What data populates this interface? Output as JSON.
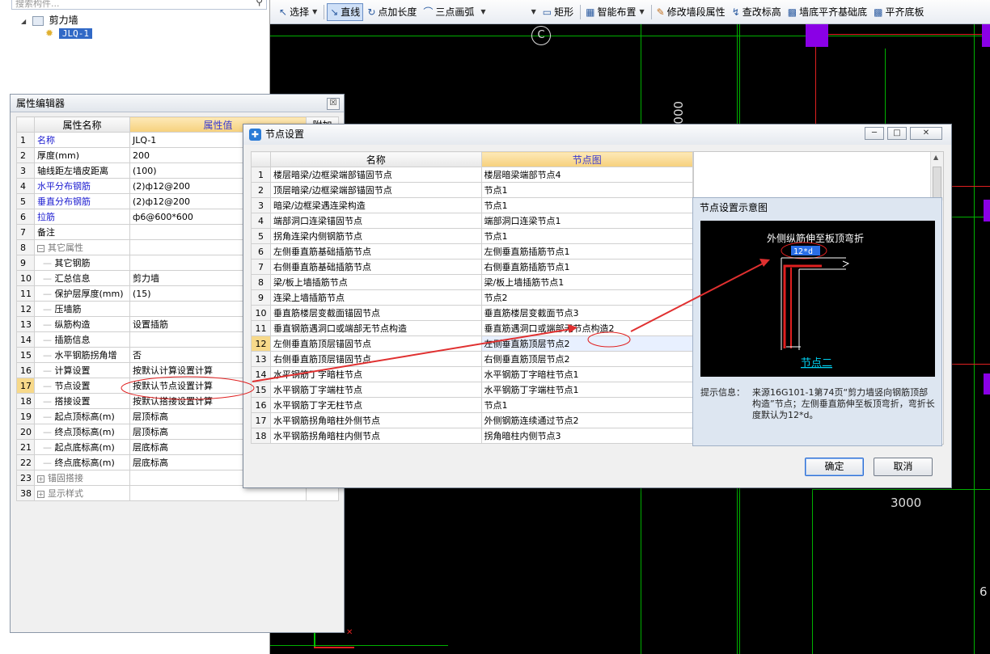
{
  "tree": {
    "search_placeholder": "搜索构件...",
    "root_label": "剪力墙",
    "child_label": "JLQ-1"
  },
  "toolbar": {
    "select": "选择",
    "line": "直线",
    "point_length": "点加长度",
    "arc": "三点画弧",
    "rect": "矩形",
    "smart": "智能布置",
    "modify": "修改墙段属性",
    "elevation": "查改标高",
    "align_base": "墙底平齐基础底",
    "align_slab": "平齐底板"
  },
  "canvas": {
    "axis_label": "C",
    "dim_vertical": "000",
    "dim_3000": "3000",
    "dim_6": "6"
  },
  "property_editor": {
    "title": "属性编辑器",
    "col_name": "属性名称",
    "col_value": "属性值",
    "col_extra": "附加",
    "rows": [
      {
        "num": "1",
        "name": "名称",
        "value": "JLQ-1",
        "style": "blue"
      },
      {
        "num": "2",
        "name": "厚度(mm)",
        "value": "200",
        "style": ""
      },
      {
        "num": "3",
        "name": "轴线距左墙皮距离",
        "value": "(100)",
        "style": ""
      },
      {
        "num": "4",
        "name": "水平分布钢筋",
        "value": "(2)ф12@200",
        "style": "blue"
      },
      {
        "num": "5",
        "name": "垂直分布钢筋",
        "value": "(2)ф12@200",
        "style": "blue"
      },
      {
        "num": "6",
        "name": "拉筋",
        "value": "ф6@600*600",
        "style": "blue"
      },
      {
        "num": "7",
        "name": "备注",
        "value": "",
        "style": ""
      },
      {
        "num": "8",
        "name": "其它属性",
        "value": "",
        "style": "group"
      },
      {
        "num": "9",
        "name": "其它钢筋",
        "value": "",
        "style": "child"
      },
      {
        "num": "10",
        "name": "汇总信息",
        "value": "剪力墙",
        "style": "child"
      },
      {
        "num": "11",
        "name": "保护层厚度(mm)",
        "value": "(15)",
        "style": "child"
      },
      {
        "num": "12",
        "name": "压墙筋",
        "value": "",
        "style": "child"
      },
      {
        "num": "13",
        "name": "纵筋构造",
        "value": "设置插筋",
        "style": "child"
      },
      {
        "num": "14",
        "name": "插筋信息",
        "value": "",
        "style": "child"
      },
      {
        "num": "15",
        "name": "水平钢筋拐角增",
        "value": "否",
        "style": "child"
      },
      {
        "num": "16",
        "name": "计算设置",
        "value": "按默认计算设置计算",
        "style": "child"
      },
      {
        "num": "17",
        "name": "节点设置",
        "value": "按默认节点设置计算",
        "style": "childsel"
      },
      {
        "num": "18",
        "name": "搭接设置",
        "value": "按默认搭接设置计算",
        "style": "child"
      },
      {
        "num": "19",
        "name": "起点顶标高(m)",
        "value": "层顶标高",
        "style": "child"
      },
      {
        "num": "20",
        "name": "终点顶标高(m)",
        "value": "层顶标高",
        "style": "child"
      },
      {
        "num": "21",
        "name": "起点底标高(m)",
        "value": "层底标高",
        "style": "child"
      },
      {
        "num": "22",
        "name": "终点底标高(m)",
        "value": "层底标高",
        "style": "child"
      },
      {
        "num": "23",
        "name": "锚固搭接",
        "value": "",
        "style": "group"
      },
      {
        "num": "38",
        "name": "显示样式",
        "value": "",
        "style": "group"
      }
    ]
  },
  "node_dialog": {
    "title": "节点设置",
    "col_name": "名称",
    "col_diagram": "节点图",
    "rows": [
      {
        "num": "1",
        "name": "楼层暗梁/边框梁端部锚固节点",
        "value": "楼层暗梁端部节点4"
      },
      {
        "num": "2",
        "name": "顶层暗梁/边框梁端部锚固节点",
        "value": "节点1"
      },
      {
        "num": "3",
        "name": "暗梁/边框梁遇连梁构造",
        "value": "节点1"
      },
      {
        "num": "4",
        "name": "端部洞口连梁锚固节点",
        "value": "端部洞口连梁节点1"
      },
      {
        "num": "5",
        "name": "拐角连梁内侧钢筋节点",
        "value": "节点1"
      },
      {
        "num": "6",
        "name": "左侧垂直筋基础插筋节点",
        "value": "左侧垂直筋插筋节点1"
      },
      {
        "num": "7",
        "name": "右侧垂直筋基础插筋节点",
        "value": "右侧垂直筋插筋节点1"
      },
      {
        "num": "8",
        "name": "梁/板上墙插筋节点",
        "value": "梁/板上墙插筋节点1"
      },
      {
        "num": "9",
        "name": "连梁上墙插筋节点",
        "value": "节点2"
      },
      {
        "num": "10",
        "name": "垂直筋楼层变截面锚固节点",
        "value": "垂直筋楼层变截面节点3"
      },
      {
        "num": "11",
        "name": "垂直钢筋遇洞口或端部无节点构造",
        "value": "垂直筋遇洞口或端部无节点构造2"
      },
      {
        "num": "12",
        "name": "左侧垂直筋顶层锚固节点",
        "value": "左侧垂直筋顶层节点2"
      },
      {
        "num": "13",
        "name": "右侧垂直筋顶层锚固节点",
        "value": "右侧垂直筋顶层节点2"
      },
      {
        "num": "14",
        "name": "水平钢筋丁字暗柱节点",
        "value": "水平钢筋丁字暗柱节点1"
      },
      {
        "num": "15",
        "name": "水平钢筋丁字端柱节点",
        "value": "水平钢筋丁字端柱节点1"
      },
      {
        "num": "16",
        "name": "水平钢筋丁字无柱节点",
        "value": "节点1"
      },
      {
        "num": "17",
        "name": "水平钢筋拐角暗柱外侧节点",
        "value": "外侧钢筋连续通过节点2"
      },
      {
        "num": "18",
        "name": "水平钢筋拐角暗柱内侧节点",
        "value": "拐角暗柱内侧节点3"
      }
    ],
    "preview_title": "节点设置示意图",
    "diagram_caption": "外侧纵筋伸至板顶弯折",
    "diagram_dim": "12*d",
    "diagram_node": "节点二",
    "hint_label": "提示信息：",
    "hint_text": "来源16G101-1第74页“剪力墙竖向钢筋顶部构造”节点；左侧垂直筋伸至板顶弯折，弯折长度默认为12*d。",
    "ok": "确定",
    "cancel": "取消"
  }
}
